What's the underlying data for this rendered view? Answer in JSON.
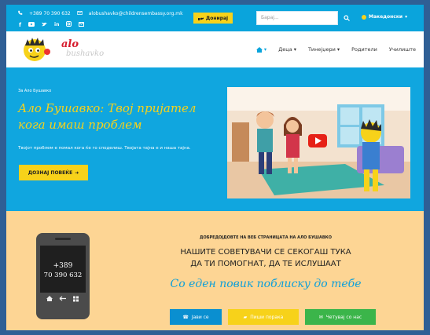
{
  "topbar": {
    "phone": "+389 70 390 632",
    "email": "alobushavko@childrensembassy.org.mk",
    "social": [
      "facebook",
      "youtube",
      "twitter",
      "linkedin",
      "instagram",
      "mail"
    ],
    "donate_label": "Донирај",
    "search_placeholder": "Барај...",
    "language": "Македонски"
  },
  "nav": {
    "logo_top": "alo",
    "logo_bottom": "bushavko",
    "items": [
      "Деца",
      "Тинејџери",
      "Родители",
      "Училиште"
    ]
  },
  "hero": {
    "breadcrumb": "За Ало Бушавко",
    "title": "Ало Бушавко: Твој пријател кога имаш проблем",
    "subtitle": "Твојот проблем е помал кога ќе го споделиш. Твојата тајна е и наша тајна.",
    "cta_label": "ДОЗНАЈ ПОВЕЌЕ"
  },
  "welcome": {
    "kicker": "ДОБРЕДОЈДОВТЕ НА ВЕБ СТРАНИЦАТА НА АЛО БУШАВКО",
    "line1": "НАШИТЕ СОВЕТУВАЧИ СЕ СЕКОГАШ ТУКА",
    "line2": "ДА ТИ ПОМОГНАТ, ДА ТЕ ИСЛУШААТ",
    "script": "Со еден повик поблиску до тебе",
    "phone_line1": "+389",
    "phone_line2": "70 390 632",
    "buttons": {
      "call": "Јави се",
      "write": "Пиши порака",
      "chat": "Четувај со нас"
    }
  },
  "colors": {
    "accent_blue": "#0aa4dc",
    "yellow": "#f7d21a",
    "peach": "#fdd594",
    "green": "#3bb54a"
  }
}
